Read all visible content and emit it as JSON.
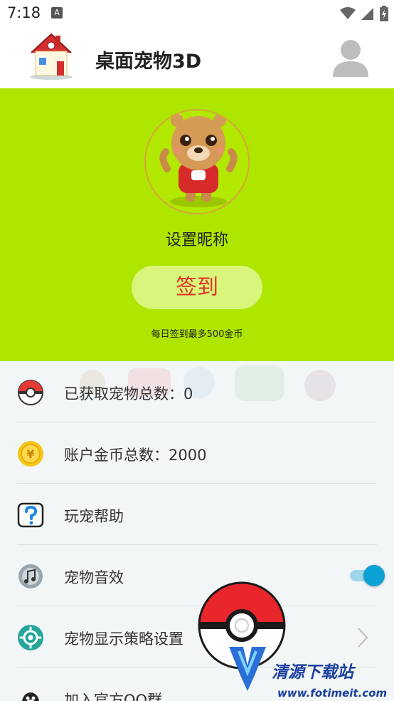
{
  "status_bar": {
    "time": "7:18",
    "notification_glyph": "A",
    "icons": [
      "wifi-icon",
      "signal-icon",
      "battery-icon"
    ]
  },
  "header": {
    "title": "桌面宠物3D",
    "logo_icon": "house-icon",
    "avatar_icon": "user-avatar-icon"
  },
  "hero": {
    "pet_icon": "bear-pet-icon",
    "nickname": "设置昵称",
    "signin_label": "签到",
    "signin_hint": "每日签到最多500金币",
    "bg_color": "#aee600"
  },
  "menu": {
    "items": [
      {
        "icon": "pokeball-icon",
        "label": "已获取宠物总数：0"
      },
      {
        "icon": "coin-icon",
        "label": "账户金币总数：2000"
      },
      {
        "icon": "help-icon",
        "label": "玩宠帮助"
      },
      {
        "icon": "music-icon",
        "label": "宠物音效",
        "toggle_on": true
      },
      {
        "icon": "gear-icon",
        "label": "宠物显示策略设置"
      },
      {
        "icon": "qq-icon",
        "label": "加入官方QQ群"
      }
    ]
  },
  "watermark": {
    "cn": "清源下载站",
    "url": "www.fotimeit.com"
  },
  "accent_color": "#0aa2d4"
}
